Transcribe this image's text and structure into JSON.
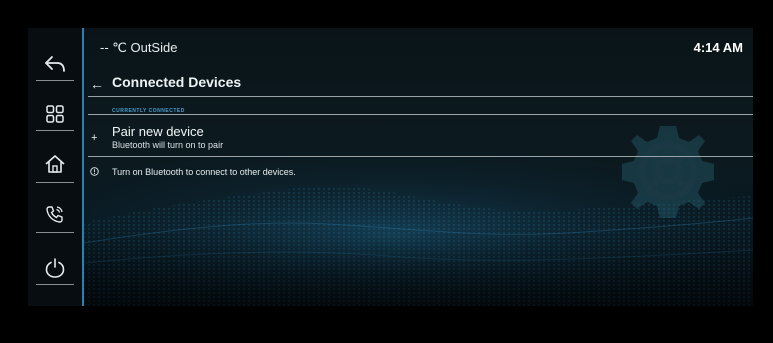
{
  "status_bar": {
    "temperature": "-- ℃ OutSide",
    "time": "4:14 AM"
  },
  "header": {
    "title": "Connected Devices"
  },
  "connected_section": {
    "caption": "CURRENTLY CONNECTED"
  },
  "pair_item": {
    "title": "Pair new device",
    "subtitle": "Bluetooth will turn on to pair"
  },
  "info": {
    "text": "Turn on Bluetooth to connect to other devices."
  },
  "sidebar": {
    "items": [
      {
        "icon": "back-arrow-icon"
      },
      {
        "icon": "grid-apps-icon"
      },
      {
        "icon": "home-icon"
      },
      {
        "icon": "phone-call-icon"
      },
      {
        "icon": "power-icon"
      }
    ]
  },
  "colors": {
    "accent": "#2d7fb0",
    "caption": "#4a9fd0",
    "background": "#0b1a20"
  }
}
